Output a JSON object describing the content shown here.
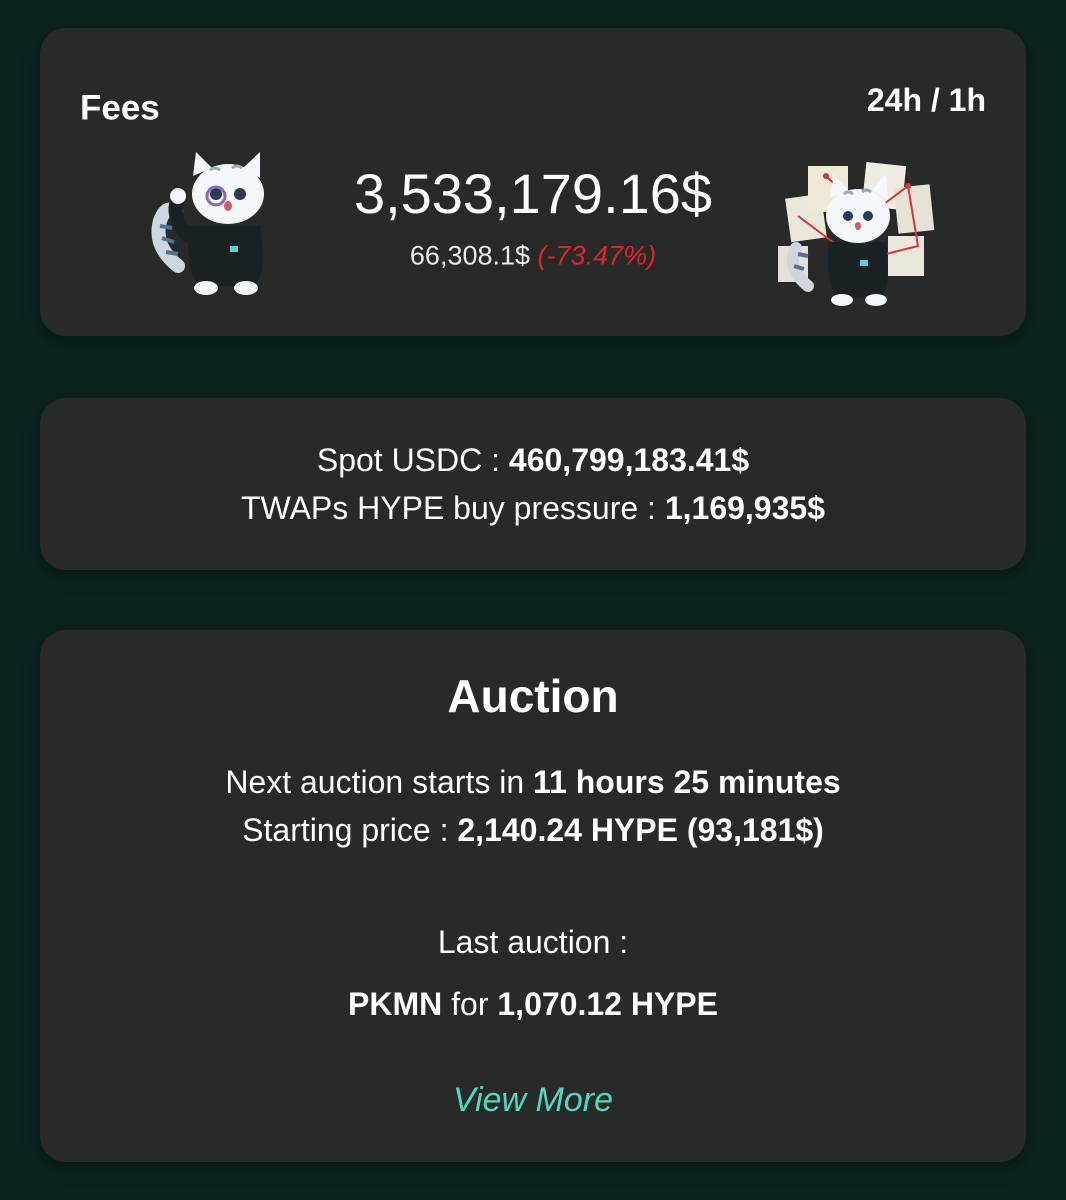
{
  "fees": {
    "title": "Fees",
    "period": "24h / 1h",
    "total": "3,533,179.16$",
    "hourly": "66,308.1$",
    "change": "(-73.47%)",
    "change_color": "#e0232b"
  },
  "spot": {
    "usdc_label": "Spot USDC : ",
    "usdc_value": "460,799,183.41$",
    "twaps_label": "TWAPs HYPE buy pressure : ",
    "twaps_value": "1,169,935$"
  },
  "auction": {
    "title": "Auction",
    "next_label": "Next auction starts in ",
    "next_value": "11 hours 25 minutes",
    "price_label": "Starting price : ",
    "price_value": "2,140.24 HYPE (93,181$)",
    "last_label": "Last auction :",
    "last_ticker": "PKMN",
    "last_for": " for ",
    "last_value": "1,070.12 HYPE",
    "view_more": "View More",
    "link_color": "#58d5c2"
  },
  "icons": {
    "left": "cat-mascot-waving-icon",
    "right": "cat-mascot-with-papers-icon"
  }
}
